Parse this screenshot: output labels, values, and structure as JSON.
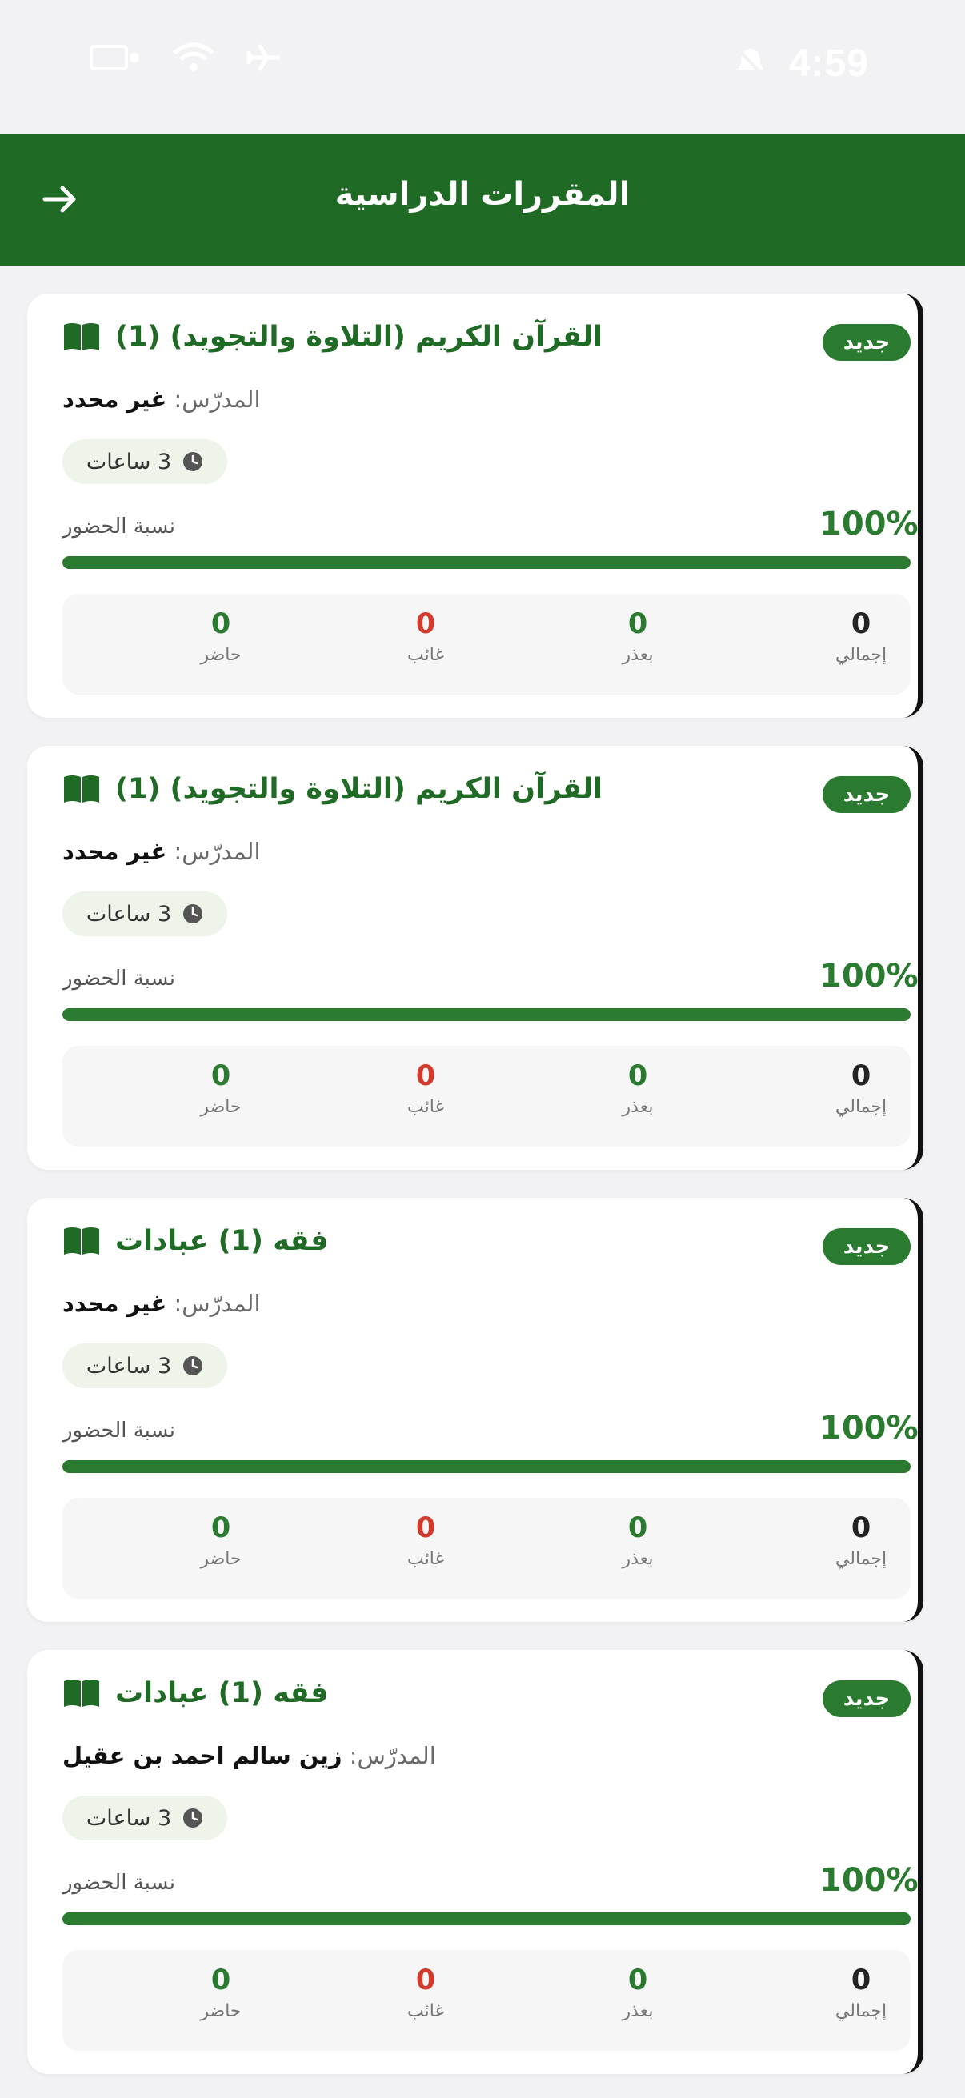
{
  "status_bar": {
    "time": "4:59"
  },
  "header": {
    "title": "المقررات الدراسية",
    "back_icon": "arrow-right-icon"
  },
  "theme": {
    "primary": "#1f6b25",
    "accent": "#2a7a30",
    "danger": "#d33a2c"
  },
  "courses": [
    {
      "badge": "جديد",
      "title": "القرآن الكريم (التلاوة والتجويد) (1)",
      "instructor_label": "المدرّس:",
      "instructor_name": "غير محدد",
      "hours": "3 ساعات",
      "attendance_label": "نسبة الحضور",
      "attendance_percent": "100%",
      "attendance_fraction": 1.0,
      "stats": {
        "present_value": "0",
        "present_label": "حاضر",
        "absent_value": "0",
        "absent_label": "غائب",
        "excused_value": "0",
        "excused_label": "بعذر",
        "total_value": "0",
        "total_label": "إجمالي"
      }
    },
    {
      "badge": "جديد",
      "title": "القرآن الكريم (التلاوة والتجويد) (1)",
      "instructor_label": "المدرّس:",
      "instructor_name": "غير محدد",
      "hours": "3 ساعات",
      "attendance_label": "نسبة الحضور",
      "attendance_percent": "100%",
      "attendance_fraction": 1.0,
      "stats": {
        "present_value": "0",
        "present_label": "حاضر",
        "absent_value": "0",
        "absent_label": "غائب",
        "excused_value": "0",
        "excused_label": "بعذر",
        "total_value": "0",
        "total_label": "إجمالي"
      }
    },
    {
      "badge": "جديد",
      "title": "فقه (1) عبادات",
      "instructor_label": "المدرّس:",
      "instructor_name": "غير محدد",
      "hours": "3 ساعات",
      "attendance_label": "نسبة الحضور",
      "attendance_percent": "100%",
      "attendance_fraction": 1.0,
      "stats": {
        "present_value": "0",
        "present_label": "حاضر",
        "absent_value": "0",
        "absent_label": "غائب",
        "excused_value": "0",
        "excused_label": "بعذر",
        "total_value": "0",
        "total_label": "إجمالي"
      }
    },
    {
      "badge": "جديد",
      "title": "فقه (1) عبادات",
      "instructor_label": "المدرّس:",
      "instructor_name": "زين سالم احمد بن عقيل",
      "hours": "3 ساعات",
      "attendance_label": "نسبة الحضور",
      "attendance_percent": "100%",
      "attendance_fraction": 1.0,
      "stats": {
        "present_value": "0",
        "present_label": "حاضر",
        "absent_value": "0",
        "absent_label": "غائب",
        "excused_value": "0",
        "excused_label": "بعذر",
        "total_value": "0",
        "total_label": "إجمالي"
      }
    }
  ]
}
